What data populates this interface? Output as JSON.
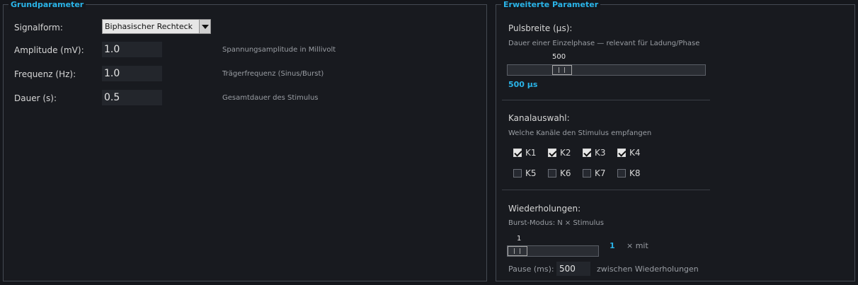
{
  "grund": {
    "title": "Grundparameter",
    "signalform_label": "Signalform:",
    "signalform_value": "Biphasischer Rechteck",
    "amplitude_label": "Amplitude (mV):",
    "amplitude_value": "1.0",
    "amplitude_hint": "Spannungsamplitude in Millivolt",
    "frequenz_label": "Frequenz (Hz):",
    "frequenz_value": "1.0",
    "frequenz_hint": "Trägerfrequenz (Sinus/Burst)",
    "dauer_label": "Dauer (s):",
    "dauer_value": "0.5",
    "dauer_hint": "Gesamtdauer des Stimulus"
  },
  "erweitert": {
    "title": "Erweiterte Parameter",
    "pulsbreite": {
      "label": "Pulsbreite (µs):",
      "hint": "Dauer einer Einzelphase — relevant für Ladung/Phase",
      "slider_value": "500",
      "display": "500 µs",
      "slider_fraction": 0.25
    },
    "kanal": {
      "label": "Kanalauswahl:",
      "hint": "Welche Kanäle den Stimulus empfangen",
      "channels": [
        {
          "name": "K1",
          "checked": true
        },
        {
          "name": "K2",
          "checked": true
        },
        {
          "name": "K3",
          "checked": true
        },
        {
          "name": "K4",
          "checked": true
        },
        {
          "name": "K5",
          "checked": false
        },
        {
          "name": "K6",
          "checked": false
        },
        {
          "name": "K7",
          "checked": false
        },
        {
          "name": "K8",
          "checked": false
        }
      ]
    },
    "wiederholungen": {
      "label": "Wiederholungen:",
      "hint": "Burst-Modus: N × Stimulus",
      "slider_value": "1",
      "display": "1",
      "suffix": "× mit",
      "pause_label": "Pause (ms):",
      "pause_value": "500",
      "pause_suffix": "zwischen Wiederholungen",
      "slider_fraction": 0.0
    }
  },
  "colors": {
    "accent": "#2ab4e8",
    "background": "#15171c"
  }
}
